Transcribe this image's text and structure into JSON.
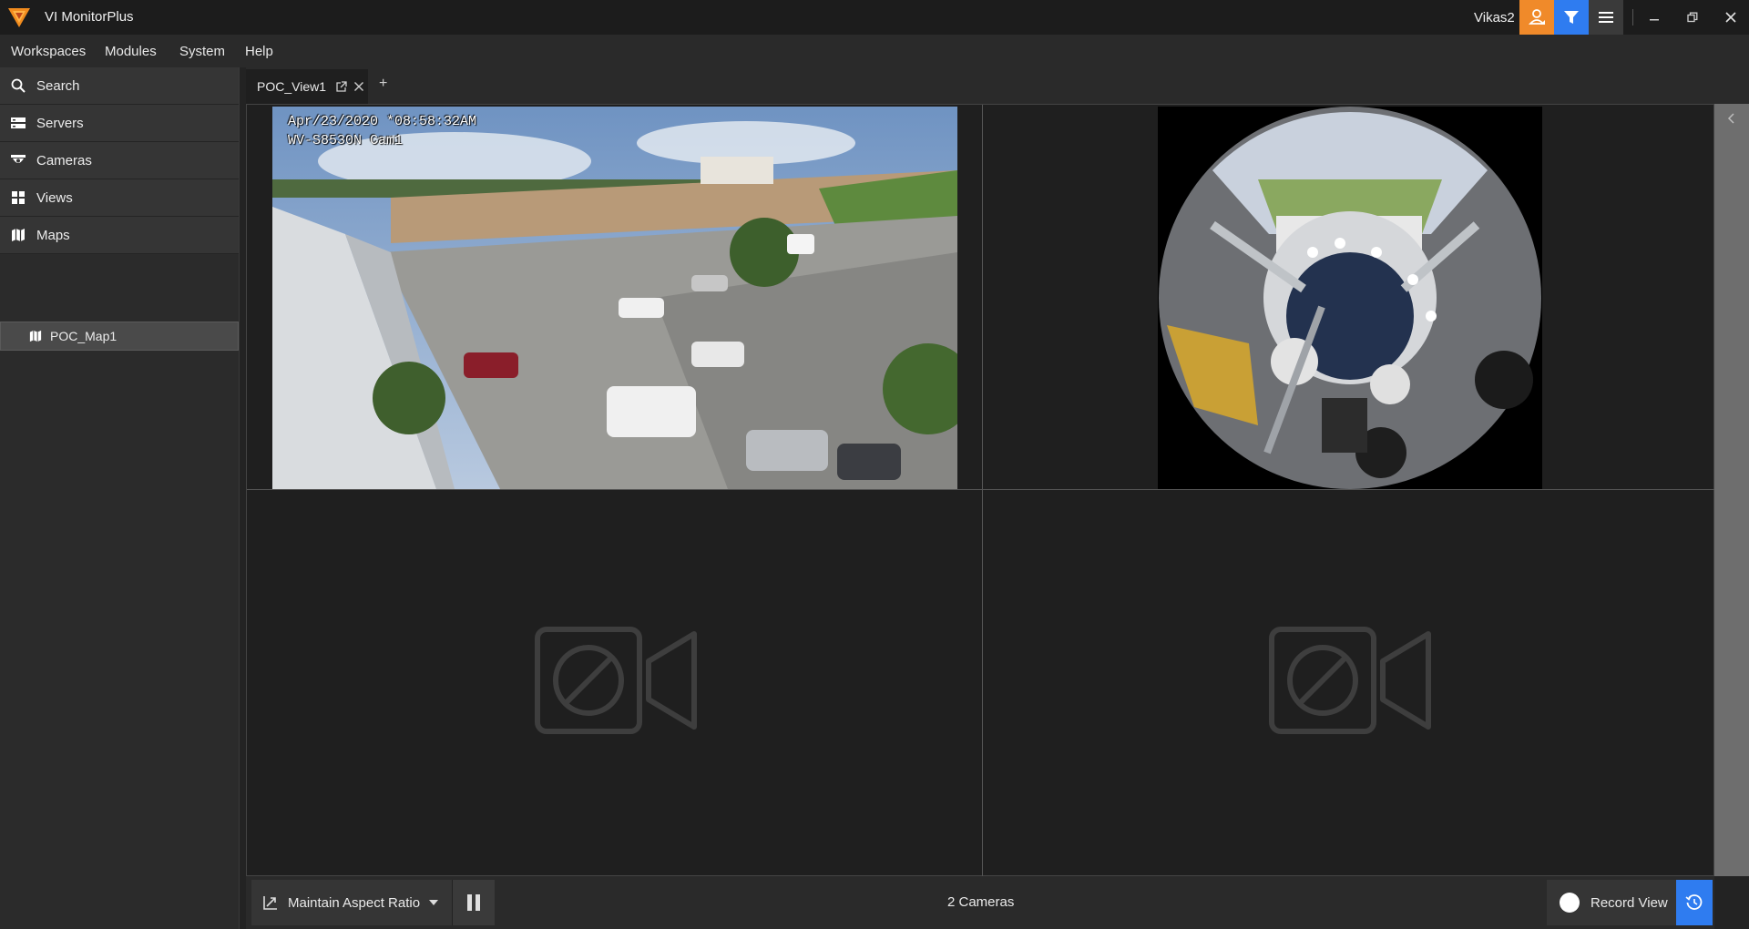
{
  "app": {
    "title": "VI MonitorPlus",
    "user": "Vikas2"
  },
  "titlebar": {
    "icons": [
      "user-alert-icon",
      "filter-icon",
      "hamburger-menu-icon",
      "minimize-icon",
      "restore-icon",
      "close-icon"
    ]
  },
  "menu": {
    "items": [
      "Workspaces",
      "Modules",
      "System",
      "Help"
    ]
  },
  "sidebar": {
    "items": [
      {
        "label": "Search",
        "icon": "search-icon"
      },
      {
        "label": "Servers",
        "icon": "server-icon"
      },
      {
        "label": "Cameras",
        "icon": "dome-camera-icon"
      },
      {
        "label": "Views",
        "icon": "grid-view-icon"
      },
      {
        "label": "Maps",
        "icon": "map-icon"
      }
    ],
    "sub_items": [
      {
        "label": "POC_Map1",
        "icon": "map-icon"
      }
    ]
  },
  "tabs": {
    "items": [
      {
        "label": "POC_View1"
      }
    ],
    "add_label": "+"
  },
  "view": {
    "cells": [
      {
        "type": "camera",
        "osd_timestamp": "Apr/23/2020 *08:58:32AM",
        "osd_camera": "WV-S8530N Cam1"
      },
      {
        "type": "camera-fisheye"
      },
      {
        "type": "empty",
        "icon": "no-camera-icon"
      },
      {
        "type": "empty",
        "icon": "no-camera-icon"
      }
    ]
  },
  "bottom": {
    "aspect_label": "Maintain Aspect Ratio",
    "camera_count": "2 Cameras",
    "record_label": "Record View"
  },
  "colors": {
    "accent_orange": "#f08a2a",
    "accent_blue": "#2f7cf0",
    "background": "#232323"
  }
}
